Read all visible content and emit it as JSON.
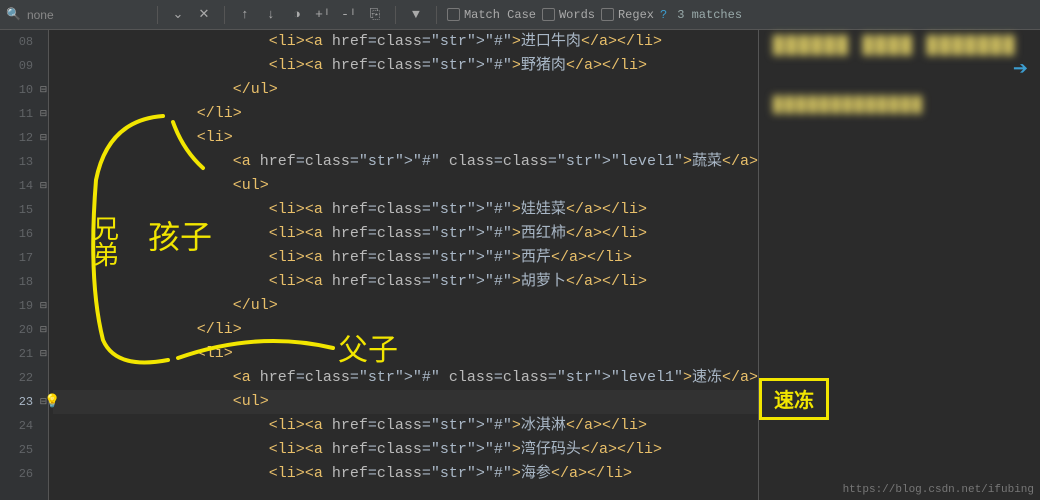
{
  "find": {
    "placeholder": "none",
    "match_case": "Match Case",
    "words": "Words",
    "regex": "Regex",
    "qmark": "?",
    "matches": "3 matches"
  },
  "gutter": [
    "08",
    "09",
    "10",
    "11",
    "12",
    "13",
    "14",
    "15",
    "16",
    "17",
    "18",
    "19",
    "20",
    "21",
    "22",
    "23",
    "24",
    "25",
    "26"
  ],
  "current_line_index": 15,
  "code": {
    "l08": "                        <li><a href=\"#\">进口牛肉</a></li>",
    "l09": "                        <li><a href=\"#\">野猪肉</a></li>",
    "l10": "                    </ul>",
    "l11": "                </li>",
    "l12": "                <li>",
    "l13": "                    <a href=\"#\" class=\"level1\">蔬菜</a>",
    "l14": "                    <ul>",
    "l15": "                        <li><a href=\"#\">娃娃菜</a></li>",
    "l16": "                        <li><a href=\"#\">西红柿</a></li>",
    "l17": "                        <li><a href=\"#\">西芹</a></li>",
    "l18": "                        <li><a href=\"#\">胡萝卜</a></li>",
    "l19": "                    </ul>",
    "l20": "                </li>",
    "l21": "                <li>",
    "l22": "                    <a href=\"#\" class=\"level1\">速冻</a>",
    "l23": "                    <ul>",
    "l24": "                        <li><a href=\"#\">冰淇淋</a></li>",
    "l25": "                        <li><a href=\"#\">湾仔码头</a></li>",
    "l26": "                        <li><a href=\"#\">海参</a></li>"
  },
  "annotations": {
    "sibling": "兄弟",
    "child": "孩子",
    "parentchild": "父子"
  },
  "preview_highlight": "速冻",
  "watermark": "https://blog.csdn.net/ifubing",
  "blur_text1": "██████ ████ ███████",
  "blur_text2": "█████████████"
}
